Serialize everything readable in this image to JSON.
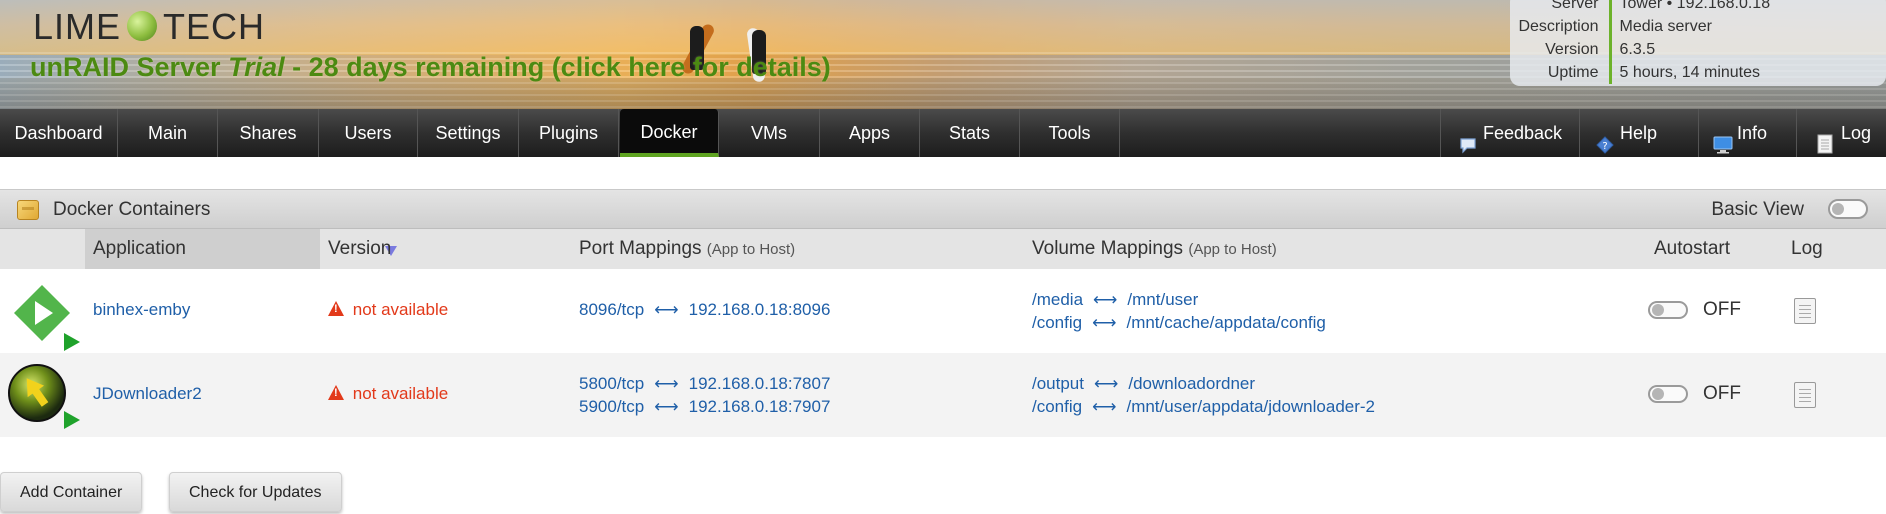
{
  "header": {
    "logo_left": "LIME",
    "logo_right": "TECH",
    "trial_prefix": "unRAID Server ",
    "trial_em": "Trial",
    "trial_suffix": " - 28 days remaining (click here for details)",
    "server_info": [
      {
        "label": "Server",
        "value": "Tower • 192.168.0.18"
      },
      {
        "label": "Description",
        "value": "Media server"
      },
      {
        "label": "Version",
        "value": "6.3.5"
      },
      {
        "label": "Uptime",
        "value": "5 hours, 14 minutes"
      }
    ]
  },
  "nav": {
    "tabs": [
      "Dashboard",
      "Main",
      "Shares",
      "Users",
      "Settings",
      "Plugins",
      "Docker",
      "VMs",
      "Apps",
      "Stats",
      "Tools"
    ],
    "active": "Docker",
    "right": [
      {
        "label": "Feedback",
        "icon": "speech-bubble-icon"
      },
      {
        "label": "Help",
        "icon": "help-diamond-icon"
      },
      {
        "label": "Info",
        "icon": "monitor-icon"
      },
      {
        "label": "Log",
        "icon": "document-icon"
      }
    ]
  },
  "panel": {
    "title": "Docker Containers",
    "basic_view_label": "Basic View"
  },
  "columns": {
    "application": "Application",
    "version": "Version",
    "ports": "Port Mappings",
    "ports_sub": "(App to Host)",
    "volumes": "Volume Mappings",
    "volumes_sub": "(App to Host)",
    "autostart": "Autostart",
    "log": "Log"
  },
  "containers": [
    {
      "name": "binhex-emby",
      "version": "not available",
      "ports": [
        {
          "app": "8096/tcp",
          "host": "192.168.0.18:8096"
        }
      ],
      "volumes": [
        {
          "app": "/media",
          "host": "/mnt/user"
        },
        {
          "app": "/config",
          "host": "/mnt/cache/appdata/config"
        }
      ],
      "autostart": "OFF"
    },
    {
      "name": "JDownloader2",
      "version": "not available",
      "ports": [
        {
          "app": "5800/tcp",
          "host": "192.168.0.18:7807"
        },
        {
          "app": "5900/tcp",
          "host": "192.168.0.18:7907"
        }
      ],
      "volumes": [
        {
          "app": "/output",
          "host": "/downloadordner"
        },
        {
          "app": "/config",
          "host": "/mnt/user/appdata/jdownloader-2"
        }
      ],
      "autostart": "OFF"
    }
  ],
  "buttons": {
    "add_container": "Add Container",
    "check_updates": "Check for Updates"
  },
  "colors": {
    "accent_green": "#5fa421",
    "link_blue": "#1f5fa8",
    "warning_red": "#e2391a"
  }
}
